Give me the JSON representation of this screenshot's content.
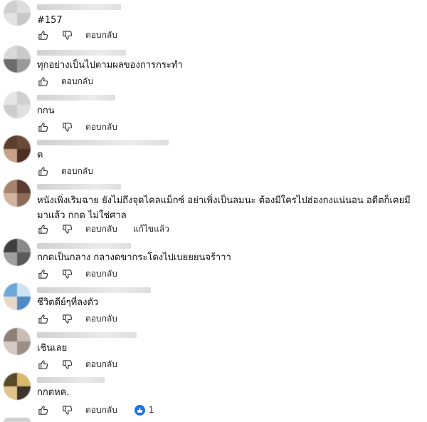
{
  "labels": {
    "reply": "ตอบกลับ",
    "edited": "แก้ไขแล้ว"
  },
  "icons": {
    "like": "thumbs-up-icon",
    "dislike": "thumbs-down-icon",
    "reaction": "like-reaction-icon"
  },
  "colors": {
    "accent": "#1b74e4",
    "text": "#0f0f0f",
    "muted": "#333333"
  },
  "comments": [
    {
      "text": "#157"
    },
    {
      "text": "ทุกอย่างเป็นไปตามผลของการกระทำ"
    },
    {
      "text": "กกน"
    },
    {
      "text": "ด"
    },
    {
      "text": "หนังเพิ่งเริมฉาย ยังไม่ถึงจุดไคลแม็กซ์ อย่าเพิ่งเป็นลมนะ ต้องมีใครไปฮ่องกงแน่นอน อดีตก็เคยมีมาแล้ว กกด ไม่ใช่ศาล"
    },
    {
      "text": "กกดเป็นกลาง กลางดขากระโดงไปเบยยยนจร้าาา"
    },
    {
      "text": "ชีวิตดีย์ๆที่ลงตัว"
    },
    {
      "text": "เชินเลย"
    },
    {
      "text": "กกตหค.",
      "likes": "1"
    }
  ]
}
